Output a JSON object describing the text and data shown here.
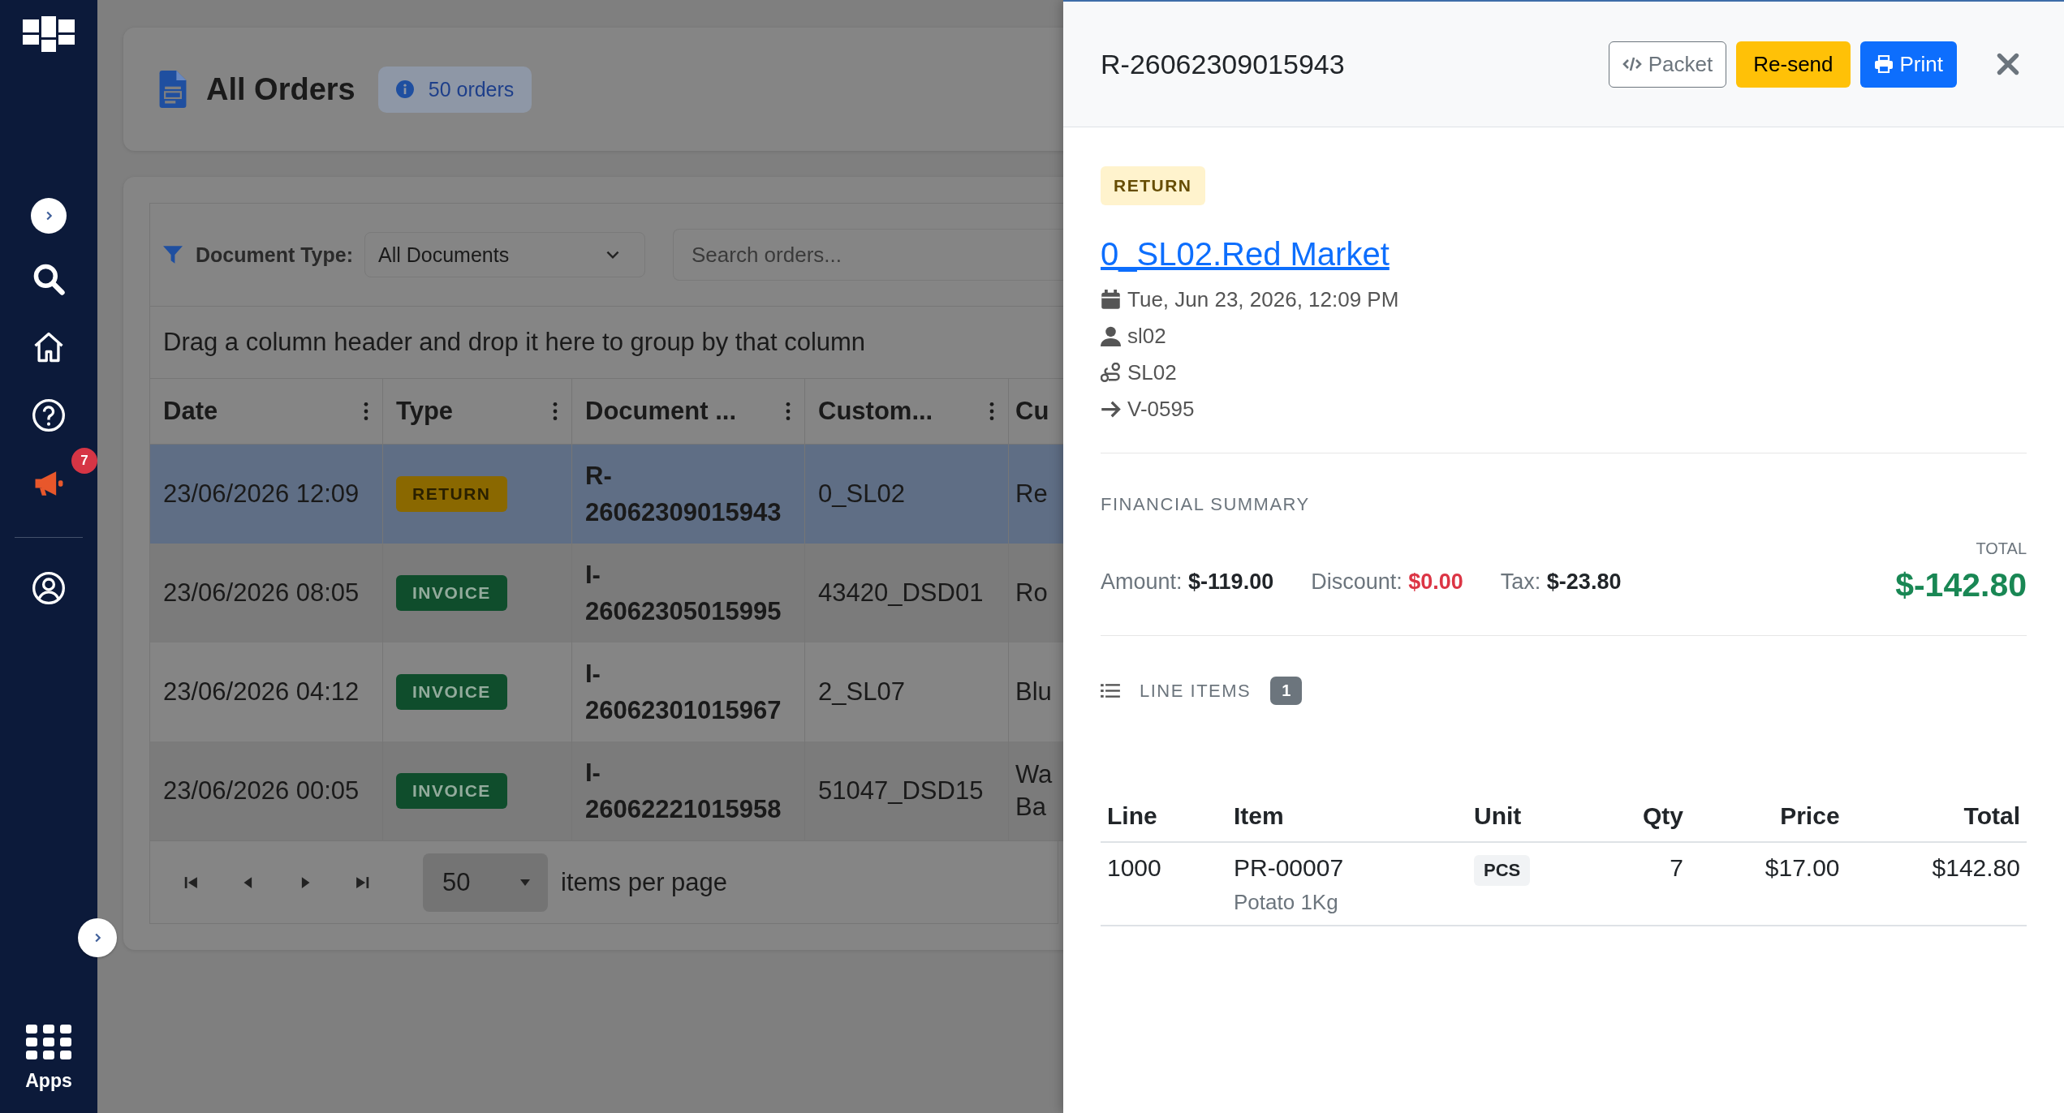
{
  "sidebar": {
    "notification_badge": "7",
    "apps_label": "Apps"
  },
  "header": {
    "title": "All Orders",
    "count_badge": "50 orders"
  },
  "toolbar": {
    "filter_label": "Document Type:",
    "filter_value": "All Documents",
    "search": {
      "placeholder": "Search orders..."
    }
  },
  "group_hint": "Drag a column header and drop it here to group by that column",
  "table": {
    "columns": [
      "Date",
      "Type",
      "Document ...",
      "Custom...",
      "Cu"
    ],
    "rows": [
      {
        "date": "23/06/2026 12:09",
        "type": "RETURN",
        "kind": "return",
        "document": "R-26062309015943",
        "customer_code": "0_SL02",
        "column_5": "Re",
        "selected": true
      },
      {
        "date": "23/06/2026 08:05",
        "type": "INVOICE",
        "kind": "invoice",
        "document": "I-26062305015995",
        "customer_code": "43420_DSD01",
        "column_5": "Ro",
        "selected": false
      },
      {
        "date": "23/06/2026 04:12",
        "type": "INVOICE",
        "kind": "invoice",
        "document": "I-26062301015967",
        "customer_code": "2_SL07",
        "column_5": "Blu",
        "selected": false
      },
      {
        "date": "23/06/2026 00:05",
        "type": "INVOICE",
        "kind": "invoice",
        "document": "I-26062221015958",
        "customer_code": "51047_DSD15",
        "column_5": "Wa Ba",
        "selected": false
      }
    ]
  },
  "pager": {
    "page_size": "50",
    "label": "items per page"
  },
  "drawer": {
    "title": "R-26062309015943",
    "buttons": [
      {
        "label": "Packet",
        "kind": "outline"
      },
      {
        "label": "Re-send",
        "kind": "warning"
      },
      {
        "label": "Print",
        "kind": "primary"
      }
    ],
    "status_badge": "RETURN",
    "customer_link": "0_SL02.Red Market",
    "meta": [
      {
        "kind": "date",
        "text": "Tue, Jun 23, 2026, 12:09 PM"
      },
      {
        "kind": "user",
        "text": "sl02"
      },
      {
        "kind": "route",
        "text": "SL02"
      },
      {
        "kind": "arrow",
        "text": "V-0595"
      }
    ],
    "financial": {
      "title": "FINANCIAL SUMMARY",
      "amount_label": "Amount:",
      "amount": "$-119.00",
      "discount_label": "Discount:",
      "discount": "$0.00",
      "tax_label": "Tax:",
      "tax": "$-23.80",
      "total_label": "TOTAL",
      "total": "$-142.80"
    },
    "line_items": {
      "title": "LINE ITEMS",
      "count": "1",
      "columns": [
        "Line",
        "Item",
        "Unit",
        "Qty",
        "Price",
        "Total"
      ],
      "rows": [
        {
          "line": "1000",
          "item": "PR-00007",
          "description": "Potato 1Kg",
          "unit": "PCS",
          "qty": "7",
          "price": "$17.00",
          "total": "$142.80"
        }
      ]
    }
  }
}
